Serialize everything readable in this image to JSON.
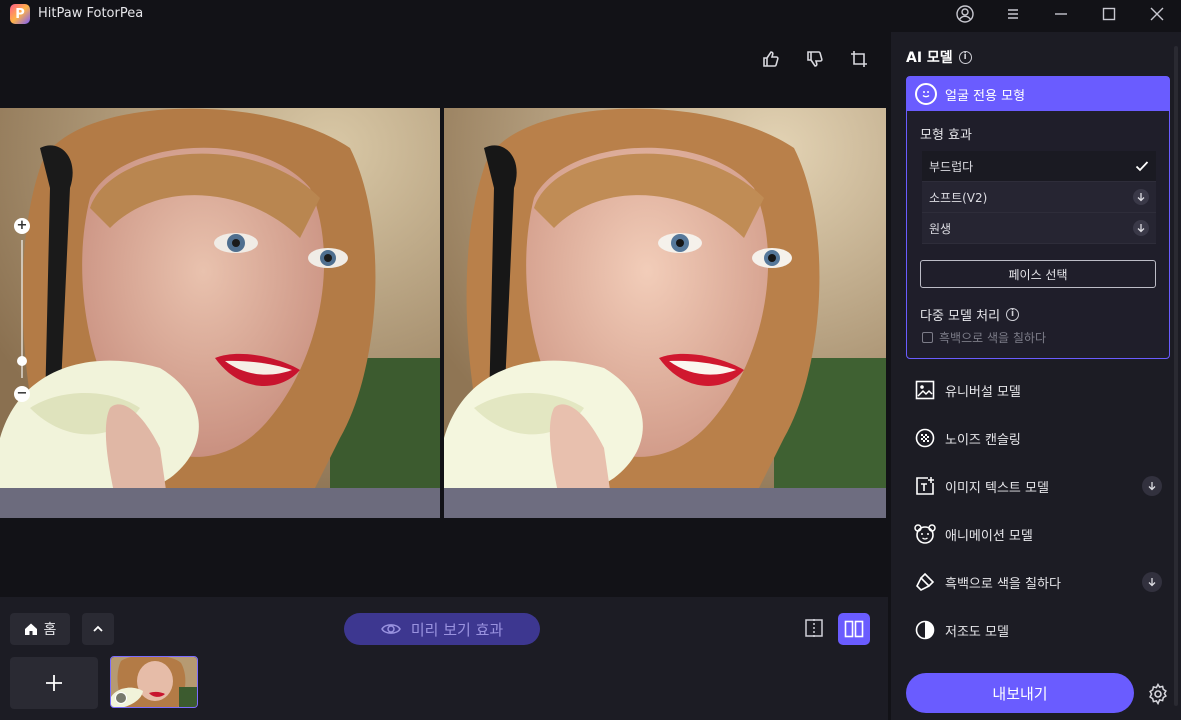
{
  "app": {
    "title": "HitPaw FotorPea",
    "logo_letter": "P"
  },
  "toolbar": {
    "like": "thumbs-up-icon",
    "dislike": "thumbs-down-icon",
    "crop": "crop-icon"
  },
  "zoom": {
    "plus": "+",
    "minus": "−",
    "level": 0.12
  },
  "bottom": {
    "home_label": "홈",
    "preview_label": "미리 보기 효과"
  },
  "panel": {
    "title": "AI 모델",
    "active_model": "얼굴 전용 모형",
    "effect_label": "모형 효과",
    "options": [
      {
        "label": "부드럽다",
        "state": "selected"
      },
      {
        "label": "소프트(V2)",
        "state": "download"
      },
      {
        "label": "원생",
        "state": "download"
      }
    ],
    "face_select": "페이스 선택",
    "multi_label": "다중 모델 처리",
    "colorize_checkbox": "흑백으로 색을 칠하다",
    "models": [
      {
        "label": "유니버설 모델",
        "icon": "image-icon",
        "download": false
      },
      {
        "label": "노이즈 캔슬링",
        "icon": "noise-icon",
        "download": false
      },
      {
        "label": "이미지 텍스트 모델",
        "icon": "text-image-icon",
        "download": true
      },
      {
        "label": "애니메이션 모델",
        "icon": "bear-face-icon",
        "download": false
      },
      {
        "label": "흑백으로 색을 칠하다",
        "icon": "brush-icon",
        "download": true
      },
      {
        "label": "저조도 모델",
        "icon": "contrast-icon",
        "download": false
      }
    ],
    "export_label": "내보내기"
  },
  "colors": {
    "accent": "#6a5cff",
    "background": "#121217",
    "panel": "#1c1c24"
  }
}
